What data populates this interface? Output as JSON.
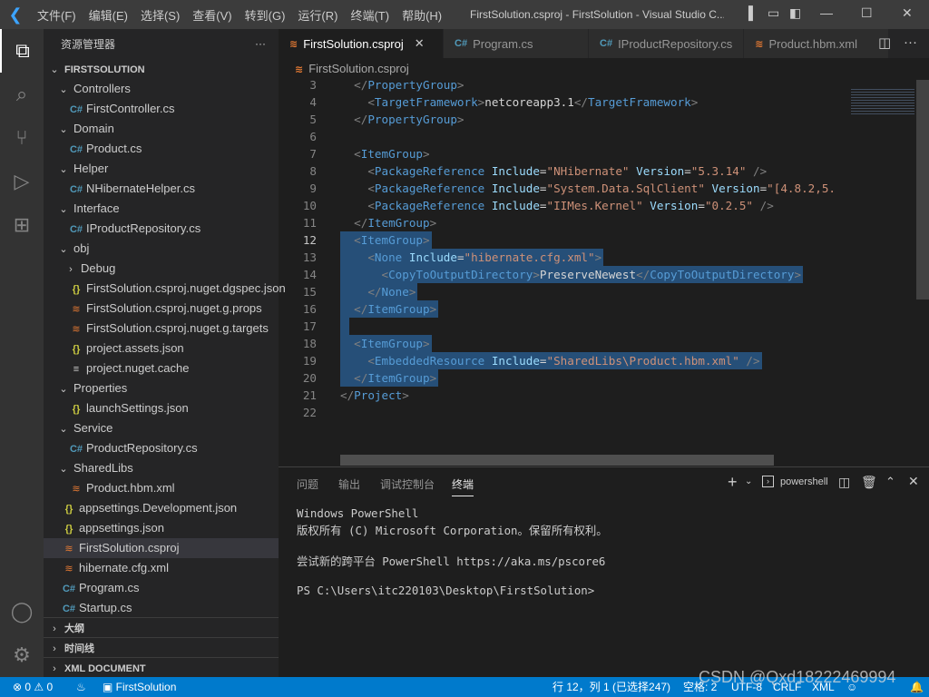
{
  "titlebar": {
    "menus": [
      "文件(F)",
      "编辑(E)",
      "选择(S)",
      "查看(V)",
      "转到(G)",
      "运行(R)",
      "终端(T)",
      "帮助(H)"
    ],
    "title": "FirstSolution.csproj - FirstSolution - Visual Studio C..."
  },
  "sidebar": {
    "title": "资源管理器",
    "more": "···",
    "root": "FIRSTSOLUTION",
    "items": [
      {
        "label": "Controllers",
        "depth": 1,
        "type": "folder"
      },
      {
        "label": "FirstController.cs",
        "depth": 2,
        "type": "cs"
      },
      {
        "label": "Domain",
        "depth": 1,
        "type": "folder"
      },
      {
        "label": "Product.cs",
        "depth": 2,
        "type": "cs"
      },
      {
        "label": "Helper",
        "depth": 1,
        "type": "folder"
      },
      {
        "label": "NHibernateHelper.cs",
        "depth": 2,
        "type": "cs"
      },
      {
        "label": "Interface",
        "depth": 1,
        "type": "folder"
      },
      {
        "label": "IProductRepository.cs",
        "depth": 2,
        "type": "cs"
      },
      {
        "label": "obj",
        "depth": 1,
        "type": "folder"
      },
      {
        "label": "Debug",
        "depth": 2,
        "type": "folder-closed"
      },
      {
        "label": "FirstSolution.csproj.nuget.dgspec.json",
        "depth": 2,
        "type": "json"
      },
      {
        "label": "FirstSolution.csproj.nuget.g.props",
        "depth": 2,
        "type": "rss"
      },
      {
        "label": "FirstSolution.csproj.nuget.g.targets",
        "depth": 2,
        "type": "rss"
      },
      {
        "label": "project.assets.json",
        "depth": 2,
        "type": "json"
      },
      {
        "label": "project.nuget.cache",
        "depth": 2,
        "type": "text"
      },
      {
        "label": "Properties",
        "depth": 1,
        "type": "folder"
      },
      {
        "label": "launchSettings.json",
        "depth": 2,
        "type": "json"
      },
      {
        "label": "Service",
        "depth": 1,
        "type": "folder"
      },
      {
        "label": "ProductRepository.cs",
        "depth": 2,
        "type": "cs"
      },
      {
        "label": "SharedLibs",
        "depth": 1,
        "type": "folder"
      },
      {
        "label": "Product.hbm.xml",
        "depth": 2,
        "type": "rss"
      },
      {
        "label": "appsettings.Development.json",
        "depth": 1,
        "type": "json"
      },
      {
        "label": "appsettings.json",
        "depth": 1,
        "type": "json"
      },
      {
        "label": "FirstSolution.csproj",
        "depth": 1,
        "type": "rss",
        "selected": true
      },
      {
        "label": "hibernate.cfg.xml",
        "depth": 1,
        "type": "rss"
      },
      {
        "label": "Program.cs",
        "depth": 1,
        "type": "cs"
      },
      {
        "label": "Startup.cs",
        "depth": 1,
        "type": "cs"
      }
    ],
    "sections": [
      "大纲",
      "时间线",
      "XML DOCUMENT"
    ]
  },
  "tabs": [
    {
      "label": "FirstSolution.csproj",
      "icon": "rss",
      "active": true
    },
    {
      "label": "Program.cs",
      "icon": "cs"
    },
    {
      "label": "IProductRepository.cs",
      "icon": "cs"
    },
    {
      "label": "Product.hbm.xml",
      "icon": "rss"
    }
  ],
  "breadcrumb": "FirstSolution.csproj",
  "editor": {
    "current_line": 12,
    "lines": [
      {
        "n": 3,
        "t": [
          [
            "br",
            "  </"
          ],
          [
            "tag",
            "PropertyGroup"
          ],
          [
            "br",
            ">"
          ]
        ]
      },
      {
        "n": 4,
        "t": [
          [
            "br",
            "    <"
          ],
          [
            "tag",
            "TargetFramework"
          ],
          [
            "br",
            ">"
          ],
          [
            "txt",
            "netcoreapp3.1"
          ],
          [
            "br",
            "</"
          ],
          [
            "tag",
            "TargetFramework"
          ],
          [
            "br",
            ">"
          ]
        ]
      },
      {
        "n": 5,
        "t": [
          [
            "br",
            "  </"
          ],
          [
            "tag",
            "PropertyGroup"
          ],
          [
            "br",
            ">"
          ]
        ]
      },
      {
        "n": 6,
        "t": []
      },
      {
        "n": 7,
        "t": [
          [
            "br",
            "  <"
          ],
          [
            "tag",
            "ItemGroup"
          ],
          [
            "br",
            ">"
          ]
        ]
      },
      {
        "n": 8,
        "t": [
          [
            "br",
            "    <"
          ],
          [
            "tag",
            "PackageReference"
          ],
          [
            "txt",
            " "
          ],
          [
            "attr",
            "Include"
          ],
          [
            "txt",
            "="
          ],
          [
            "str",
            "\"NHibernate\""
          ],
          [
            "txt",
            " "
          ],
          [
            "attr",
            "Version"
          ],
          [
            "txt",
            "="
          ],
          [
            "str",
            "\"5.3.14\""
          ],
          [
            "txt",
            " "
          ],
          [
            "br",
            "/>"
          ]
        ]
      },
      {
        "n": 9,
        "t": [
          [
            "br",
            "    <"
          ],
          [
            "tag",
            "PackageReference"
          ],
          [
            "txt",
            " "
          ],
          [
            "attr",
            "Include"
          ],
          [
            "txt",
            "="
          ],
          [
            "str",
            "\"System.Data.SqlClient\""
          ],
          [
            "txt",
            " "
          ],
          [
            "attr",
            "Version"
          ],
          [
            "txt",
            "="
          ],
          [
            "str",
            "\"[4.8.2,5."
          ]
        ]
      },
      {
        "n": 10,
        "t": [
          [
            "br",
            "    <"
          ],
          [
            "tag",
            "PackageReference"
          ],
          [
            "txt",
            " "
          ],
          [
            "attr",
            "Include"
          ],
          [
            "txt",
            "="
          ],
          [
            "str",
            "\"IIMes.Kernel\""
          ],
          [
            "txt",
            " "
          ],
          [
            "attr",
            "Version"
          ],
          [
            "txt",
            "="
          ],
          [
            "str",
            "\"0.2.5\""
          ],
          [
            "txt",
            " "
          ],
          [
            "br",
            "/>"
          ]
        ]
      },
      {
        "n": 11,
        "t": [
          [
            "br",
            "  </"
          ],
          [
            "tag",
            "ItemGroup"
          ],
          [
            "br",
            ">"
          ]
        ]
      },
      {
        "n": 12,
        "sel": true,
        "t": [
          [
            "br",
            "  <"
          ],
          [
            "tag",
            "ItemGroup"
          ],
          [
            "br",
            ">"
          ]
        ]
      },
      {
        "n": 13,
        "sel": true,
        "t": [
          [
            "br",
            "    <"
          ],
          [
            "tag",
            "None"
          ],
          [
            "txt",
            " "
          ],
          [
            "attr",
            "Include"
          ],
          [
            "txt",
            "="
          ],
          [
            "str",
            "\"hibernate.cfg.xml\""
          ],
          [
            "br",
            ">"
          ]
        ]
      },
      {
        "n": 14,
        "sel": true,
        "t": [
          [
            "br",
            "      <"
          ],
          [
            "tag",
            "CopyToOutputDirectory"
          ],
          [
            "br",
            ">"
          ],
          [
            "txt",
            "PreserveNewest"
          ],
          [
            "br",
            "</"
          ],
          [
            "tag",
            "CopyToOutputDirectory"
          ],
          [
            "br",
            ">"
          ]
        ]
      },
      {
        "n": 15,
        "sel": true,
        "t": [
          [
            "br",
            "    </"
          ],
          [
            "tag",
            "None"
          ],
          [
            "br",
            ">"
          ]
        ]
      },
      {
        "n": 16,
        "sel": true,
        "t": [
          [
            "br",
            "  </"
          ],
          [
            "tag",
            "ItemGroup"
          ],
          [
            "br",
            ">"
          ]
        ]
      },
      {
        "n": 17,
        "sel": true,
        "t": [
          [
            "txt",
            "  "
          ]
        ]
      },
      {
        "n": 18,
        "sel": true,
        "t": [
          [
            "br",
            "  <"
          ],
          [
            "tag",
            "ItemGroup"
          ],
          [
            "br",
            ">"
          ]
        ]
      },
      {
        "n": 19,
        "sel": true,
        "t": [
          [
            "br",
            "    <"
          ],
          [
            "tag",
            "EmbeddedResource"
          ],
          [
            "txt",
            " "
          ],
          [
            "attr",
            "Include"
          ],
          [
            "txt",
            "="
          ],
          [
            "str",
            "\"SharedLibs\\Product.hbm.xml\""
          ],
          [
            "txt",
            " "
          ],
          [
            "br",
            "/>"
          ]
        ]
      },
      {
        "n": 20,
        "sel": true,
        "t": [
          [
            "br",
            "  </"
          ],
          [
            "tag",
            "ItemGroup"
          ],
          [
            "br",
            ">"
          ]
        ]
      },
      {
        "n": 21,
        "t": [
          [
            "br",
            "</"
          ],
          [
            "tag",
            "Project"
          ],
          [
            "br",
            ">"
          ]
        ]
      },
      {
        "n": 22,
        "t": []
      }
    ]
  },
  "panel": {
    "tabs": [
      "问题",
      "输出",
      "调试控制台",
      "终端"
    ],
    "active_tab": "终端",
    "terminal_name": "powershell",
    "terminal_lines": [
      "Windows PowerShell",
      "版权所有 (C) Microsoft Corporation。保留所有权利。",
      "",
      "尝试新的跨平台 PowerShell https://aka.ms/pscore6",
      "",
      "PS C:\\Users\\itc220103\\Desktop\\FirstSolution>"
    ]
  },
  "status": {
    "errors": "0",
    "warnings": "0",
    "folder": "FirstSolution",
    "position": "行 12，列 1 (已选择247)",
    "indent": "空格: 2",
    "encoding": "UTF-8",
    "eol": "CRLF",
    "language": "XML"
  },
  "watermark": "CSDN @Qxd18222469994"
}
